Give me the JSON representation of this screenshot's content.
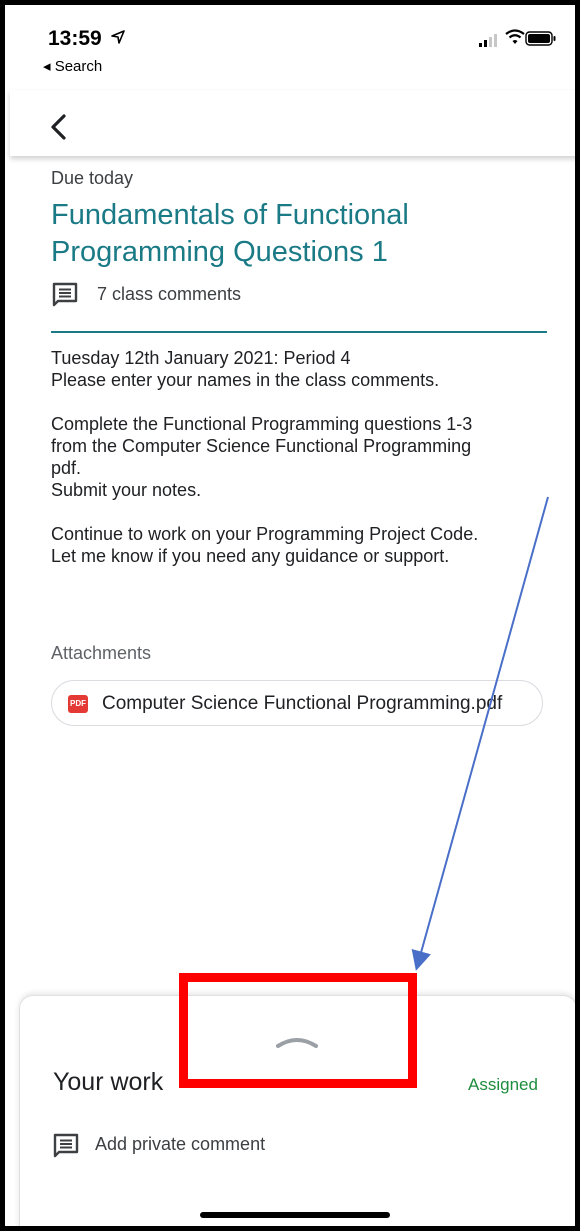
{
  "status_bar": {
    "time": "13:59",
    "back_app_label": "◂ Search"
  },
  "assignment": {
    "due": "Due today",
    "title": "Fundamentals of Functional Programming Questions 1",
    "comments_label": "7 class comments",
    "description": [
      "Tuesday 12th January 2021: Period 4\nPlease enter your names in the class comments.",
      "Complete the Functional Programming questions 1-3\nfrom the Computer Science Functional Programming\npdf.\nSubmit your notes.",
      "Continue to work on your Programming Project Code.\nLet me know if you need any guidance or support."
    ]
  },
  "attachments": {
    "heading": "Attachments",
    "file": {
      "name": "Computer Science Functional Programming.pdf",
      "type_badge": "PDF"
    }
  },
  "your_work": {
    "title": "Your work",
    "status": "Assigned",
    "private_comment_label": "Add private comment"
  },
  "colors": {
    "accent": "#1a7a86",
    "status_green": "#1e8e3e",
    "annotation_red": "#ff0000",
    "annotation_arrow": "#4a6fc8"
  },
  "icons": [
    "location-arrow-icon",
    "signal-icon",
    "wifi-icon",
    "battery-icon",
    "back-arrow-icon",
    "comments-icon",
    "pdf-icon",
    "chevron-up-icon",
    "private-comment-icon"
  ]
}
